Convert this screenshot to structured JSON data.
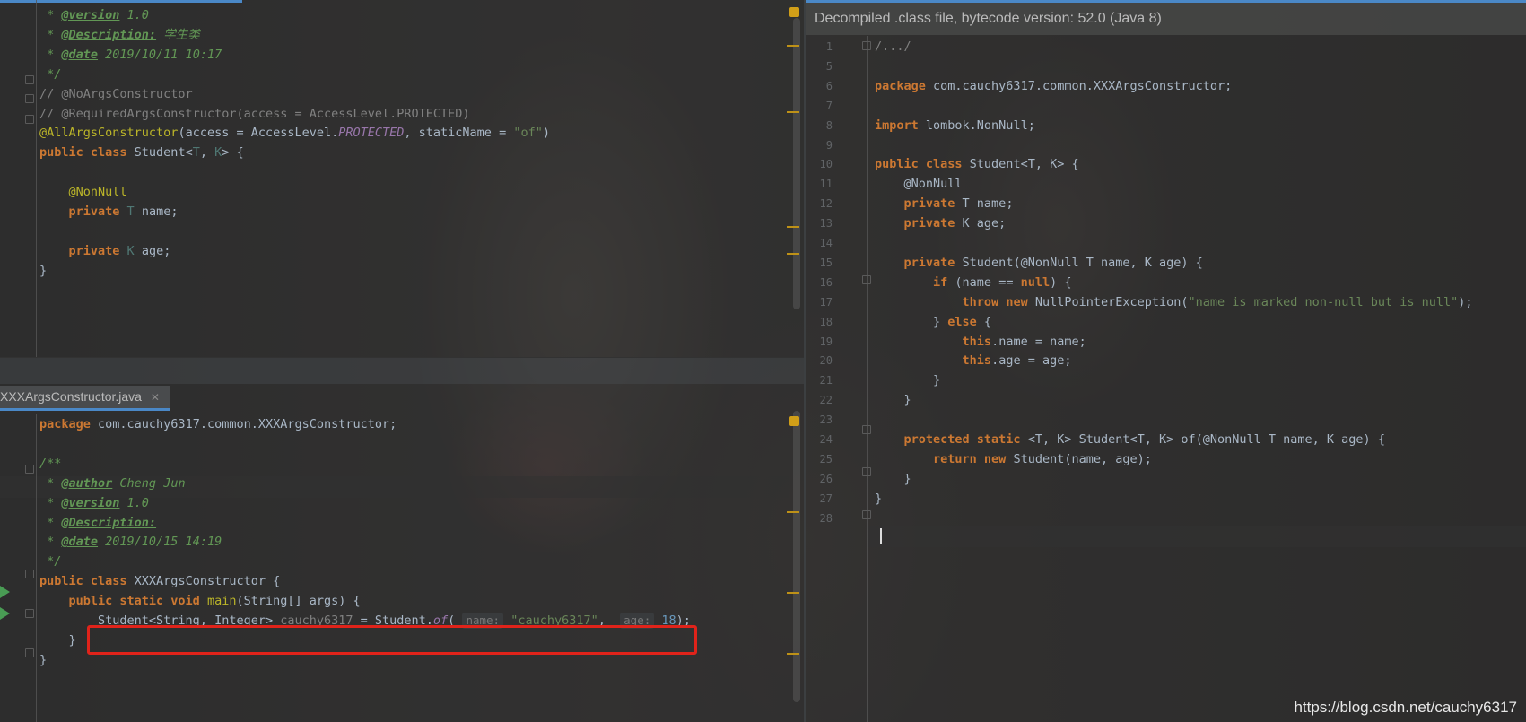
{
  "top_editor": {
    "lines": [
      [
        {
          "t": " * ",
          "c": "cmt"
        },
        {
          "t": "@version",
          "c": "tag"
        },
        {
          "t": " 1.0",
          "c": "cmt"
        }
      ],
      [
        {
          "t": " * ",
          "c": "cmt"
        },
        {
          "t": "@Description:",
          "c": "tag"
        },
        {
          "t": " 学生类",
          "c": "cmt"
        }
      ],
      [
        {
          "t": " * ",
          "c": "cmt"
        },
        {
          "t": "@date",
          "c": "tag"
        },
        {
          "t": " 2019/10/11 10:17",
          "c": "cmt"
        }
      ],
      [
        {
          "t": " */",
          "c": "cmt"
        }
      ],
      [
        {
          "t": "// @NoArgsConstructor",
          "c": "lc"
        }
      ],
      [
        {
          "t": "// @RequiredArgsConstructor(access = AccessLevel.PROTECTED)",
          "c": "lc"
        }
      ],
      [
        {
          "t": "@AllArgsConstructor",
          "c": "ann"
        },
        {
          "t": "(access = AccessLevel.",
          "c": ""
        },
        {
          "t": "PROTECTED",
          "c": "fld"
        },
        {
          "t": ", staticName = ",
          "c": ""
        },
        {
          "t": "\"of\"",
          "c": "str"
        },
        {
          "t": ")",
          "c": ""
        }
      ],
      [
        {
          "t": "public class ",
          "c": "kw"
        },
        {
          "t": "Student<",
          "c": ""
        },
        {
          "t": "T",
          "c": "tp"
        },
        {
          "t": ", ",
          "c": ""
        },
        {
          "t": "K",
          "c": "tp"
        },
        {
          "t": "> {",
          "c": ""
        }
      ],
      [],
      [
        {
          "t": "    ",
          "c": ""
        },
        {
          "t": "@NonNull",
          "c": "ann"
        }
      ],
      [
        {
          "t": "    ",
          "c": ""
        },
        {
          "t": "private ",
          "c": "kw"
        },
        {
          "t": "T ",
          "c": "tp"
        },
        {
          "t": "name;",
          "c": ""
        }
      ],
      [],
      [
        {
          "t": "    ",
          "c": ""
        },
        {
          "t": "private ",
          "c": "kw"
        },
        {
          "t": "K ",
          "c": "tp"
        },
        {
          "t": "age;",
          "c": ""
        }
      ],
      [
        {
          "t": "}",
          "c": ""
        }
      ]
    ]
  },
  "bottom_editor": {
    "tab_label": "XXXArgsConstructor.java",
    "tab_close": "✕",
    "lines": [
      [
        {
          "t": "package ",
          "c": "kw"
        },
        {
          "t": "com.cauchy6317.common.XXXArgsConstructor;",
          "c": ""
        }
      ],
      [],
      [
        {
          "t": "/**",
          "c": "cmt"
        }
      ],
      [
        {
          "t": " * ",
          "c": "cmt"
        },
        {
          "t": "@author",
          "c": "tag"
        },
        {
          "t": " Cheng Jun",
          "c": "cmt"
        }
      ],
      [
        {
          "t": " * ",
          "c": "cmt"
        },
        {
          "t": "@version",
          "c": "tag"
        },
        {
          "t": " 1.0",
          "c": "cmt"
        }
      ],
      [
        {
          "t": " * ",
          "c": "cmt"
        },
        {
          "t": "@Description:",
          "c": "tag"
        }
      ],
      [
        {
          "t": " * ",
          "c": "cmt"
        },
        {
          "t": "@date",
          "c": "tag"
        },
        {
          "t": " 2019/10/15 14:19",
          "c": "cmt"
        }
      ],
      [
        {
          "t": " */",
          "c": "cmt"
        }
      ],
      [
        {
          "t": "public class ",
          "c": "kw"
        },
        {
          "t": "XXXArgsConstructor {",
          "c": ""
        }
      ],
      [
        {
          "t": "    ",
          "c": ""
        },
        {
          "t": "public static void ",
          "c": "kw"
        },
        {
          "t": "main",
          "c": "ann"
        },
        {
          "t": "(String[] args) {",
          "c": ""
        }
      ],
      [
        {
          "t": "        Student<String, Integer> ",
          "c": ""
        },
        {
          "t": "cauchy6317",
          "c": "lc"
        },
        {
          "t": " = Student.",
          "c": ""
        },
        {
          "t": "of",
          "c": "fld"
        },
        {
          "t": "( ",
          "c": ""
        },
        {
          "t": "name:",
          "c": "hint"
        },
        {
          "t": " ",
          "c": ""
        },
        {
          "t": "\"cauchy6317\"",
          "c": "str"
        },
        {
          "t": ",  ",
          "c": ""
        },
        {
          "t": "age:",
          "c": "hint"
        },
        {
          "t": " ",
          "c": ""
        },
        {
          "t": "18",
          "c": "num"
        },
        {
          "t": ");",
          "c": ""
        }
      ],
      [
        {
          "t": "    }",
          "c": ""
        }
      ],
      [
        {
          "t": "}",
          "c": ""
        }
      ]
    ]
  },
  "right_editor": {
    "banner": "Decompiled .class file, bytecode version: 52.0 (Java 8)",
    "line_numbers": [
      "1",
      "5",
      "6",
      "7",
      "8",
      "9",
      "10",
      "11",
      "12",
      "13",
      "14",
      "15",
      "16",
      "17",
      "18",
      "19",
      "20",
      "21",
      "22",
      "23",
      "24",
      "25",
      "26",
      "27",
      "28"
    ],
    "lines": [
      [
        {
          "t": "/.../",
          "c": "lc"
        }
      ],
      [],
      [
        {
          "t": "package ",
          "c": "kw"
        },
        {
          "t": "com.cauchy6317.common.XXXArgsConstructor;",
          "c": ""
        }
      ],
      [],
      [
        {
          "t": "import ",
          "c": "kw"
        },
        {
          "t": "lombok.NonNull;",
          "c": ""
        }
      ],
      [],
      [
        {
          "t": "public class ",
          "c": "kw"
        },
        {
          "t": "Student<T, K> {",
          "c": ""
        }
      ],
      [
        {
          "t": "    @NonNull",
          "c": ""
        }
      ],
      [
        {
          "t": "    ",
          "c": ""
        },
        {
          "t": "private ",
          "c": "kw"
        },
        {
          "t": "T name;",
          "c": ""
        }
      ],
      [
        {
          "t": "    ",
          "c": ""
        },
        {
          "t": "private ",
          "c": "kw"
        },
        {
          "t": "K age;",
          "c": ""
        }
      ],
      [],
      [
        {
          "t": "    ",
          "c": ""
        },
        {
          "t": "private ",
          "c": "kw"
        },
        {
          "t": "Student(@NonNull T name, K age) {",
          "c": ""
        }
      ],
      [
        {
          "t": "        ",
          "c": ""
        },
        {
          "t": "if ",
          "c": "kw"
        },
        {
          "t": "(name == ",
          "c": ""
        },
        {
          "t": "null",
          "c": "kw"
        },
        {
          "t": ") {",
          "c": ""
        }
      ],
      [
        {
          "t": "            ",
          "c": ""
        },
        {
          "t": "throw new ",
          "c": "kw"
        },
        {
          "t": "NullPointerException(",
          "c": ""
        },
        {
          "t": "\"name is marked non-null but is null\"",
          "c": "str"
        },
        {
          "t": ");",
          "c": ""
        }
      ],
      [
        {
          "t": "        } ",
          "c": ""
        },
        {
          "t": "else ",
          "c": "kw"
        },
        {
          "t": "{",
          "c": ""
        }
      ],
      [
        {
          "t": "            ",
          "c": ""
        },
        {
          "t": "this",
          "c": "kw"
        },
        {
          "t": ".name = name;",
          "c": ""
        }
      ],
      [
        {
          "t": "            ",
          "c": ""
        },
        {
          "t": "this",
          "c": "kw"
        },
        {
          "t": ".age = age;",
          "c": ""
        }
      ],
      [
        {
          "t": "        }",
          "c": ""
        }
      ],
      [
        {
          "t": "    }",
          "c": ""
        }
      ],
      [],
      [
        {
          "t": "    ",
          "c": ""
        },
        {
          "t": "protected static ",
          "c": "kw"
        },
        {
          "t": "<T, K> Student<T, K> of(@NonNull T name, K age) {",
          "c": ""
        }
      ],
      [
        {
          "t": "        ",
          "c": ""
        },
        {
          "t": "return new ",
          "c": "kw"
        },
        {
          "t": "Student(name, age);",
          "c": ""
        }
      ],
      [
        {
          "t": "    }",
          "c": ""
        }
      ],
      [
        {
          "t": "}",
          "c": ""
        }
      ],
      []
    ]
  },
  "watermark": "https://blog.csdn.net/cauchy6317"
}
